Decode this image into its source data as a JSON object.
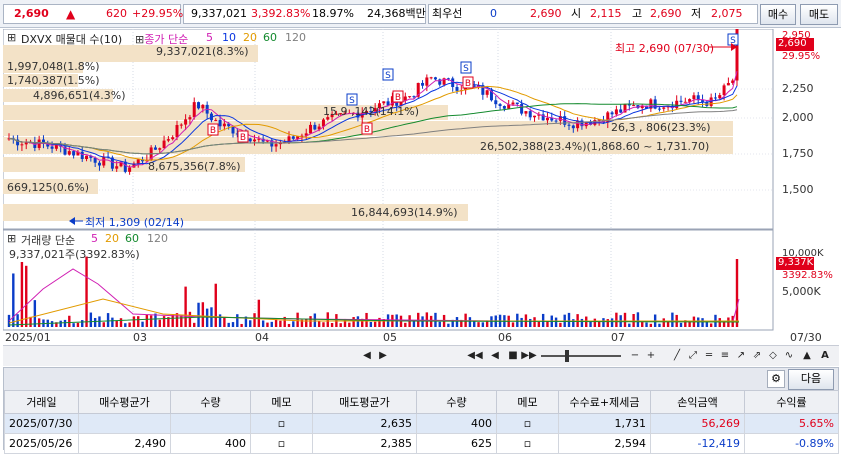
{
  "quote": {
    "price": "2,690",
    "change": "620",
    "change_pct": "+29.95%",
    "volume": "9,337,021",
    "volume_ratio": "3,392.83%",
    "turnover_pct": "18.97%",
    "amount": "24,368백만",
    "best_bid_label": "최우선",
    "best_bid_qty": "0",
    "best_bid_price": "2,690",
    "open_label": "시",
    "open": "2,115",
    "high_label": "고",
    "high": "2,690",
    "low_label": "저",
    "low": "2,075",
    "buy_button": "매수",
    "sell_button": "매도"
  },
  "chart": {
    "legend_title": "DXVX 매물대 수(10)",
    "legend_ma": "종가 단순",
    "ma_values": [
      "5",
      "10",
      "20",
      "60",
      "120"
    ],
    "ma_colors": [
      "#d01fb3",
      "#0a36e0",
      "#e29b00",
      "#148a2e",
      "#808080"
    ],
    "price_axis": [
      "2,250",
      "2,000",
      "1,750",
      "1,500"
    ],
    "price_tags": [
      "2,690",
      "29.95%"
    ],
    "price_top": "2,950",
    "high_marker": "최고 2,690 (07/30)",
    "low_marker": "최저 1,309 (02/14)",
    "vp_labels": [
      "9,337,021(8.3%)",
      "1,997,048(1.8%)",
      "1,740,387(1.5%)",
      "4,896,651(4.3%)",
      "15,9 ,142(14.1%)",
      "26,3 , 806(23.3%)",
      "26,502,388(23.4%)(1,868.60 ~ 1,731.70)",
      "8,675,356(7.8%)",
      "669,125(0.6%)",
      "16,844,693(14.9%)"
    ],
    "volume_title": "거래량 단순",
    "volume_ma": [
      "5",
      "20",
      "60",
      "120"
    ],
    "volume_current": "9,337,021주(3392.83%)",
    "volume_axis": [
      "10,000K",
      "5,000K"
    ],
    "volume_tags": [
      "9,337K",
      "3392.83%"
    ],
    "date_axis": [
      "2025/01",
      "03",
      "04",
      "05",
      "06",
      "07",
      "07/30"
    ]
  },
  "toolbar": {
    "next_button": "다음"
  },
  "table": {
    "headers": [
      "거래일",
      "매수평균가",
      "수량",
      "메모",
      "매도평균가",
      "수량",
      "메모",
      "수수료+제세금",
      "손익금액",
      "수익률"
    ],
    "rows": [
      {
        "date": "2025/07/30",
        "buy_avg": "",
        "buy_qty": "",
        "sell_avg": "2,635",
        "sell_qty": "400",
        "fee": "1,731",
        "pnl": "56,269",
        "ret": "5.65%"
      },
      {
        "date": "2025/05/26",
        "buy_avg": "2,490",
        "buy_qty": "400",
        "sell_avg": "2,385",
        "sell_qty": "625",
        "fee": "2,594",
        "pnl": "-12,419",
        "ret": "-0.89%"
      }
    ]
  },
  "colors": {
    "up": "#e0001b",
    "down": "#0a3cc8",
    "volume_profile": "#f3e2c7"
  }
}
